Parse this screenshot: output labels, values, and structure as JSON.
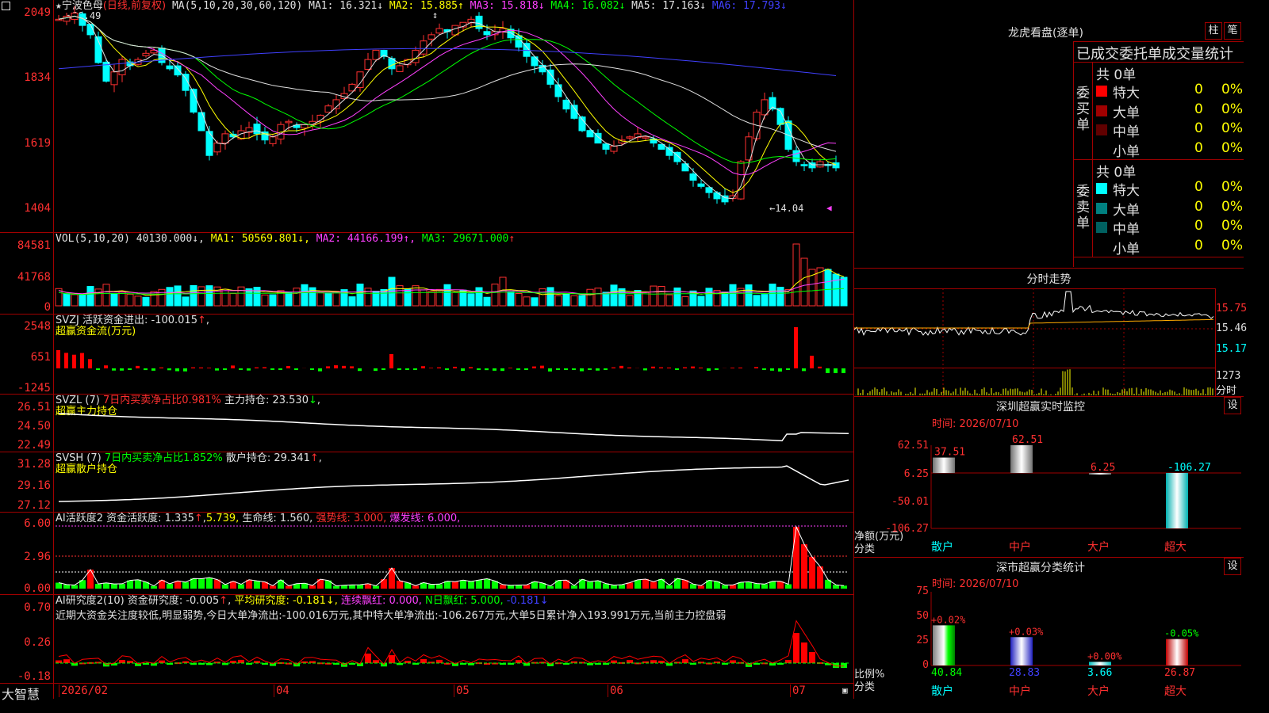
{
  "stock": {
    "name": "宁波色母",
    "period": "(日线,前复权)",
    "high_mark": "20.49",
    "low_mark": "14.04"
  },
  "main_panel": {
    "y_labels": [
      "2049",
      "1834",
      "1619",
      "1404"
    ],
    "ma_prefix": "MA(5,10,20,30,60,120)",
    "ma": [
      {
        "label": "MA1:",
        "value": "16.321",
        "arrow": "↓",
        "color": "#e0e0e0"
      },
      {
        "label": "MA2:",
        "value": "15.885",
        "arrow": "↑",
        "color": "#ffff00"
      },
      {
        "label": "MA3:",
        "value": "15.818",
        "arrow": "↓",
        "color": "#ff40ff"
      },
      {
        "label": "MA4:",
        "value": "16.082",
        "arrow": "↓",
        "color": "#00ff00"
      },
      {
        "label": "MA5:",
        "value": "17.163",
        "arrow": "↓",
        "color": "#e0e0e0"
      },
      {
        "label": "MA6:",
        "value": "17.793",
        "arrow": "↓",
        "color": "#4040ff"
      }
    ]
  },
  "vol_panel": {
    "y_labels": [
      "84581",
      "41768",
      "0"
    ],
    "prefix": "VOL(5,10,20)",
    "value": "40130.000",
    "ma1": "MA1: 50569.801",
    "ma2": "MA2: 44166.199",
    "ma3": "MA3: 29671.000"
  },
  "svzj_panel": {
    "y_labels": [
      "2548",
      "651",
      "-1245"
    ],
    "line1": "SVZJ  活跃资金进出: -100.015",
    "line2": "超赢资金流(万元)"
  },
  "svzl_panel": {
    "y_labels": [
      "26.51",
      "24.50",
      "22.49"
    ],
    "prefix": "SVZL (7)",
    "ratio": "7日内买卖净占比0.981%",
    "hold": "主力持仓: 23.530",
    "line2": "超赢主力持仓"
  },
  "svsh_panel": {
    "y_labels": [
      "31.28",
      "29.16",
      "27.12"
    ],
    "prefix": "SVSH (7)",
    "ratio": "7日内买卖净占比1.852%",
    "hold": "散户持仓: 29.341",
    "line2": "超赢散户持仓"
  },
  "ai_active_panel": {
    "y_labels": [
      "6.00",
      "2.96",
      "0.00"
    ],
    "prefix": "AI活跃度2",
    "active": "资金活跃度: 1.335",
    "v2": "5.739,",
    "life": "生命线: 1.560,",
    "strong": "强势线: 3.000,",
    "burst": "爆发线: 6.000,"
  },
  "ai_research_panel": {
    "y_labels": [
      "0.70",
      "0.26",
      "-0.18"
    ],
    "prefix": "AI研究度2(10)",
    "research": "资金研究度: -0.005",
    "avg": "平均研究度: -0.181",
    "cont": "连续飘红: 0.000,",
    "nday": "N日飘红: 5.000,",
    "last": "-0.181",
    "comment": "近期大资金关注度较低,明显弱势,今日大单净流出:-100.016万元,其中特大单净流出:-106.267万元,大单5日累计净入193.991万元,当前主力控盘弱"
  },
  "x_axis": {
    "brand": "大智慧",
    "labels": [
      "2026/02",
      "04",
      "05",
      "06",
      "07"
    ]
  },
  "dragon_tiger": {
    "title": "龙虎看盘(逐单)",
    "btn1": "柱",
    "btn2": "笔",
    "header": "已成交委托单成交量统计",
    "buy_label": "委买单",
    "sell_label": "委卖单",
    "buy_total": "共 0单",
    "sell_total": "共 0单",
    "buy_rows": [
      {
        "name": "特大",
        "count": "0",
        "pct": "0%",
        "color": "#ff0000"
      },
      {
        "name": "大单",
        "count": "0",
        "pct": "0%",
        "color": "#a00000"
      },
      {
        "name": "中单",
        "count": "0",
        "pct": "0%",
        "color": "#600000"
      },
      {
        "name": "小单",
        "count": "0",
        "pct": "0%",
        "color": ""
      }
    ],
    "sell_rows": [
      {
        "name": "特大",
        "count": "0",
        "pct": "0%",
        "color": "#00ffff"
      },
      {
        "name": "大单",
        "count": "0",
        "pct": "0%",
        "color": "#008080"
      },
      {
        "name": "中单",
        "count": "0",
        "pct": "0%",
        "color": "#006060"
      },
      {
        "name": "小单",
        "count": "0",
        "pct": "0%",
        "color": ""
      }
    ]
  },
  "intraday": {
    "title": "分时走势",
    "y_labels": [
      "15.75",
      "15.46",
      "15.17"
    ],
    "vol_label": "1273",
    "vol_unit": "分时"
  },
  "sz_monitor": {
    "title": "深圳超赢实时监控",
    "btn": "设",
    "time": "时间: 2026/07/10",
    "y_labels": [
      "62.51",
      "6.25",
      "-50.01",
      "-106.27"
    ],
    "unit1": "净额(万元)",
    "unit2": "分类",
    "categories": [
      "散户",
      "中户",
      "大户",
      "超大"
    ],
    "values": [
      37.51,
      62.51,
      6.25,
      -106.27
    ],
    "value_labels": [
      "37.51",
      "62.51",
      "6.25",
      "-106.27"
    ]
  },
  "sz_class": {
    "title": "深市超赢分类统计",
    "btn": "设",
    "time": "时间: 2026/07/10",
    "y_labels": [
      "75",
      "50",
      "25",
      "0"
    ],
    "unit1": "比例%",
    "unit2": "分类",
    "categories": [
      "散户",
      "中户",
      "大户",
      "超大"
    ],
    "values": [
      40.84,
      28.83,
      3.66,
      26.87
    ],
    "value_labels": [
      "40.84",
      "28.83",
      "3.66",
      "26.87"
    ],
    "changes": [
      "+0.02%",
      "+0.03%",
      "+0.00%",
      "-0.05%"
    ]
  }
}
